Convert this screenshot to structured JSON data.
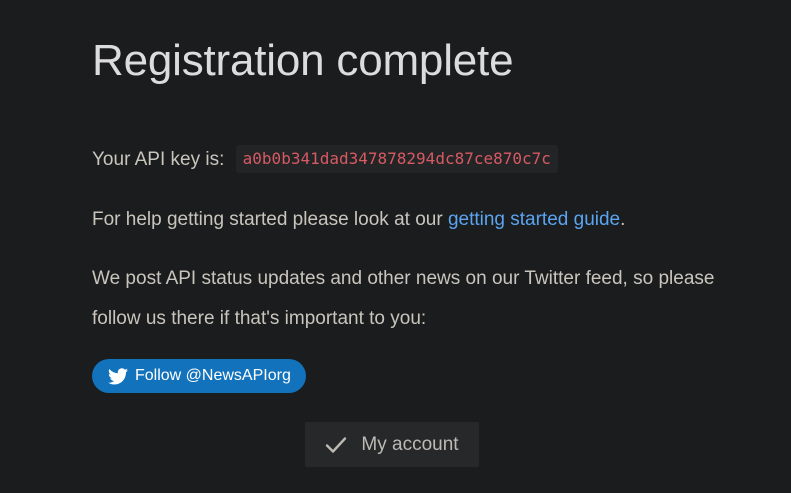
{
  "page": {
    "title": "Registration complete"
  },
  "api_key": {
    "label": "Your API key is:",
    "value": "a0b0b341dad347878294dc87ce870c7c"
  },
  "help": {
    "text_before": "For help getting started please look at our ",
    "link_text": "getting started guide",
    "text_after": "."
  },
  "news": {
    "text": "We post API status updates and other news on our Twitter feed, so please follow us there if that's important to you:"
  },
  "twitter_button": {
    "label": "Follow @NewsAPIorg",
    "icon": "twitter-bird-icon"
  },
  "account_button": {
    "label": "My account",
    "icon": "checkmark-icon"
  },
  "colors": {
    "background": "#1b1c1e",
    "link": "#5ba4f0",
    "api_key_text": "#d65a63",
    "twitter_button": "#1273bc"
  }
}
